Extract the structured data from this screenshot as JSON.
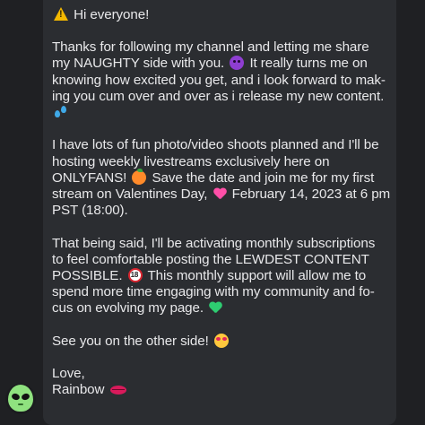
{
  "message": {
    "greeting": "Hi everyone!",
    "p1": [
      "Thanks for following my channel and letting me share",
      "my NAUGHTY side with you.",
      "It really turns me on",
      "knowing how excited you get, and i look forward to mak-",
      "ing you cum over and over as i release my new content."
    ],
    "p2": [
      "I have lots of fun photo/video shoots planned and I'll be",
      "hosting weekly livestreams exclusively here on",
      "ONLYFANS!",
      "Save the date and join me for my first",
      "stream on Valentines Day,",
      "February 14, 2023 at 6 pm",
      "PST (18:00)."
    ],
    "p3": [
      "That being said, I'll be activating monthly subscriptions",
      "to feel comfortable posting the LEWDEST CONTENT",
      "POSSIBLE.",
      "This monthly support will allow me to",
      "spend more time engaging with my community and fo-",
      "cus on evolving my page."
    ],
    "p4": "See you on the other side!",
    "signoff": [
      "Love,",
      "Rainbow"
    ]
  },
  "icons": {
    "warning": "warning-icon",
    "devil": "smiling-devil-icon",
    "drops": "sweat-droplets-icon",
    "peach": "peach-icon",
    "heart_pink": "sparkling-heart-icon",
    "no_under_18": "no-one-under-eighteen-icon",
    "heart_green": "green-heart-icon",
    "heart_eyes": "heart-eyes-icon",
    "kiss": "kiss-mark-icon",
    "avatar": "alien-avatar-icon"
  },
  "colors": {
    "background": "#1f2023",
    "bubble": "#2b2d31",
    "text": "#e8e8ea"
  }
}
